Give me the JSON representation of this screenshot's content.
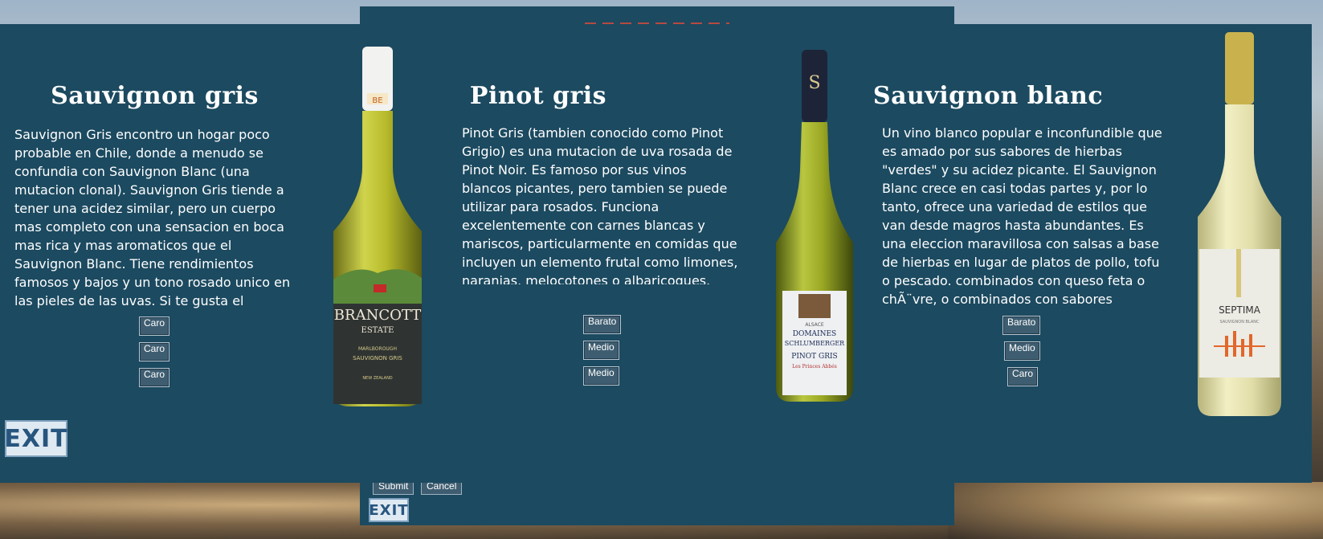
{
  "wines": [
    {
      "title": "Sauvignon gris",
      "description": "Sauvignon Gris encontro un hogar poco probable en Chile, donde a menudo se confundia con Sauvignon Blanc (una mutacion clonal). Sauvignon Gris tiende a tener una acidez similar, pero un cuerpo mas completo con una sensacion en boca mas rica y mas aromaticos que el Sauvignon Blanc. Tiene rendimientos famosos y bajos y un tono rosado unico en las pieles de las uvas. Si te gusta el Sauvignon Blanc, entonces esta es",
      "buttons": [
        "Caro",
        "Caro",
        "Caro"
      ],
      "bottle": {
        "brand": "BRANCOTT",
        "brand2": "ESTATE",
        "line1": "MARLBOROUGH",
        "line2": "SAUVIGNON GRIS",
        "line3": "NEW ZEALAND",
        "cap_label": "BE"
      }
    },
    {
      "title": "Pinot gris",
      "description": "Pinot Gris (tambien conocido como Pinot Grigio) es una mutacion de uva rosada de Pinot Noir. Es famoso por sus vinos blancos picantes, pero tambien se puede utilizar para rosados. Funciona excelentemente con carnes blancas y mariscos, particularmente en comidas que incluyen un elemento frutal como limones, naranjas, melocotones o albaricoques.",
      "buttons": [
        "Barato",
        "Medio",
        "Medio"
      ],
      "bottle": {
        "brand": "DOMAINES",
        "brand2": "SCHLUMBERGER",
        "line1": "ALSACE",
        "line2": "PINOT GRIS",
        "line3": "Les Princes Abbés",
        "cap_label": "S"
      }
    },
    {
      "title": "Sauvignon blanc",
      "description": "Un vino blanco popular e inconfundible que es amado por sus sabores de hierbas \"verdes\" y su acidez picante. El Sauvignon Blanc crece en casi todas partes y, por lo tanto, ofrece una variedad de estilos que van desde magros hasta abundantes. Es una eleccion maravillosa con salsas a base de hierbas en lugar de platos de pollo, tofu o pescado. combinados con queso feta o chÃ¨vre, o combinados con sabores asiaticos",
      "buttons": [
        "Barato",
        "Medio",
        "Caro"
      ],
      "bottle": {
        "brand": "SEPTIMA",
        "brand2": "SAUVIGNON BLANC",
        "line1": "SEPTIMA",
        "line2": "",
        "line3": "",
        "cap_label": ""
      }
    }
  ],
  "exit_label": "EXIT",
  "back_form": {
    "submit_label": "Submit",
    "cancel_label": "Cancel",
    "exit_label": "EXIT"
  },
  "colors": {
    "panel": "#1c4a60",
    "button": "#3e5d70",
    "exit_text": "#27557e"
  }
}
